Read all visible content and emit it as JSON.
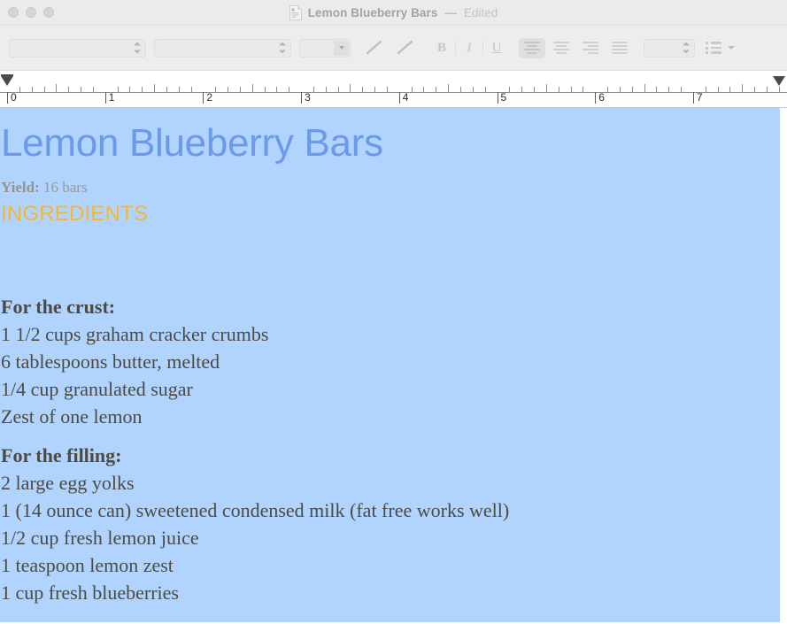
{
  "window": {
    "title": "Lemon Blueberry Bars",
    "dash": "—",
    "edited_label": "Edited",
    "doc_icon": "document-icon",
    "traffic_lights": [
      "close",
      "minimize",
      "zoom"
    ]
  },
  "toolbar": {
    "font_family": {
      "value": "",
      "placeholder": "",
      "icon": "stepper-icon"
    },
    "font_style": {
      "value": "",
      "placeholder": "",
      "icon": "stepper-icon"
    },
    "font_size_popup": {
      "value": "",
      "icon": "chevron-down-icon"
    },
    "text_color_button": "text-color-pen",
    "highlight_color_button": "highlight-color-pen",
    "bold_label": "B",
    "italic_label": "I",
    "underline_label": "U",
    "align_left": "Align Left",
    "align_center": "Align Center",
    "align_right": "Align Right",
    "align_justify": "Justify",
    "active_alignment": "Align Left",
    "line_spacing": {
      "value": "",
      "icon": "stepper-icon"
    },
    "list_button": {
      "label": "Lists",
      "icon": "bulleted-list-icon"
    }
  },
  "ruler": {
    "unit": "inches",
    "labels": [
      "0",
      "1",
      "2",
      "3",
      "4",
      "5",
      "6",
      "7"
    ],
    "left_indent_marker": "left-indent-marker",
    "right_indent_marker": "right-indent-marker"
  },
  "document": {
    "title": "Lemon Blueberry Bars",
    "yield_label": "Yield:",
    "yield_value": "16 bars",
    "section_heading": "INGREDIENTS",
    "crust_heading": "For the crust:",
    "crust_items": [
      "1 1/2 cups graham cracker crumbs",
      "6 tablespoons butter, melted",
      "1/4 cup granulated sugar",
      "Zest of one lemon"
    ],
    "filling_heading": "For the filling:",
    "filling_items": [
      "2 large egg yolks",
      "1 (14 ounce can) sweetened condensed milk (fat free works well)",
      "1/2 cup fresh lemon juice",
      "1 teaspoon lemon zest",
      "1 cup fresh blueberries"
    ]
  },
  "colors": {
    "selection_blue": "#b0d4fd",
    "title_blue": "#6d9ae8",
    "heading_orange": "#f5b731",
    "body_text": "#4d4a44",
    "yield_gray": "#9a9a94",
    "toolbar_bg": "#ededed",
    "titlebar_bg": "#ebebeb"
  }
}
